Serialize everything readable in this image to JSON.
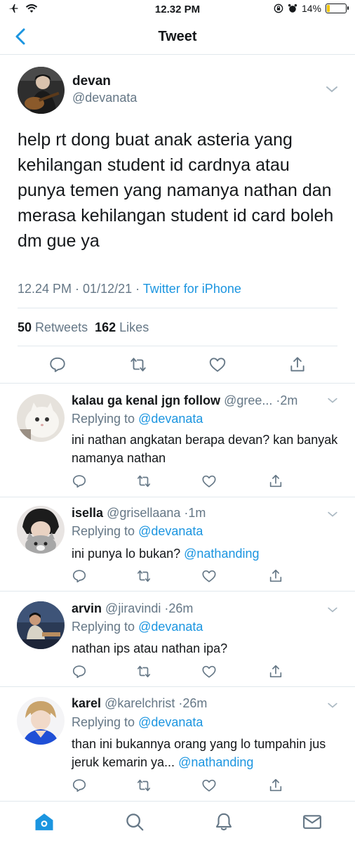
{
  "status_bar": {
    "time": "12.32 PM",
    "battery": "14%",
    "battery_level": 0.14
  },
  "navbar": {
    "title": "Tweet",
    "back_icon": "chevron-left-icon"
  },
  "tweet": {
    "name": "devan",
    "handle": "@devanata",
    "text": "help rt dong buat anak asteria yang kehilangan student id cardnya atau punya temen yang namanya nathan dan merasa kehilangan student id card boleh dm gue ya",
    "time": "12.24 PM",
    "separator": " · ",
    "date": "01/12/21",
    "source": "Twitter for iPhone",
    "retweets_count": "50",
    "retweets_label": "Retweets",
    "likes_count": "162",
    "likes_label": "Likes"
  },
  "replies": [
    {
      "name": "kalau ga kenal jgn follow",
      "handle": "@gree...",
      "time": "·2m",
      "replying_label": "Replying to",
      "replying_to": "@devanata",
      "text": "ini nathan angkatan berapa devan? kan banyak namanya nathan",
      "mention": ""
    },
    {
      "name": "isella",
      "handle": "@grisellaana",
      "time": "·1m",
      "replying_label": "Replying to",
      "replying_to": "@devanata",
      "text": "ini punya lo bukan?",
      "mention": "@nathanding"
    },
    {
      "name": "arvin",
      "handle": "@jiravindi",
      "time": "·26m",
      "replying_label": "Replying to",
      "replying_to": "@devanata",
      "text": "nathan ips atau nathan ipa?",
      "mention": ""
    },
    {
      "name": "karel",
      "handle": "@karelchrist",
      "time": "·26m",
      "replying_label": "Replying to",
      "replying_to": "@devanata",
      "text": "than ini bukannya orang yang lo tumpahin jus jeruk kemarin ya...",
      "mention": "@nathanding"
    }
  ],
  "colors": {
    "accent": "#1b95e0",
    "secondary_text": "#657786",
    "divider": "#e1e8ed",
    "battery": "#f5c400"
  },
  "tab_bar": [
    "home-icon",
    "search-icon",
    "notifications-icon",
    "messages-icon"
  ]
}
